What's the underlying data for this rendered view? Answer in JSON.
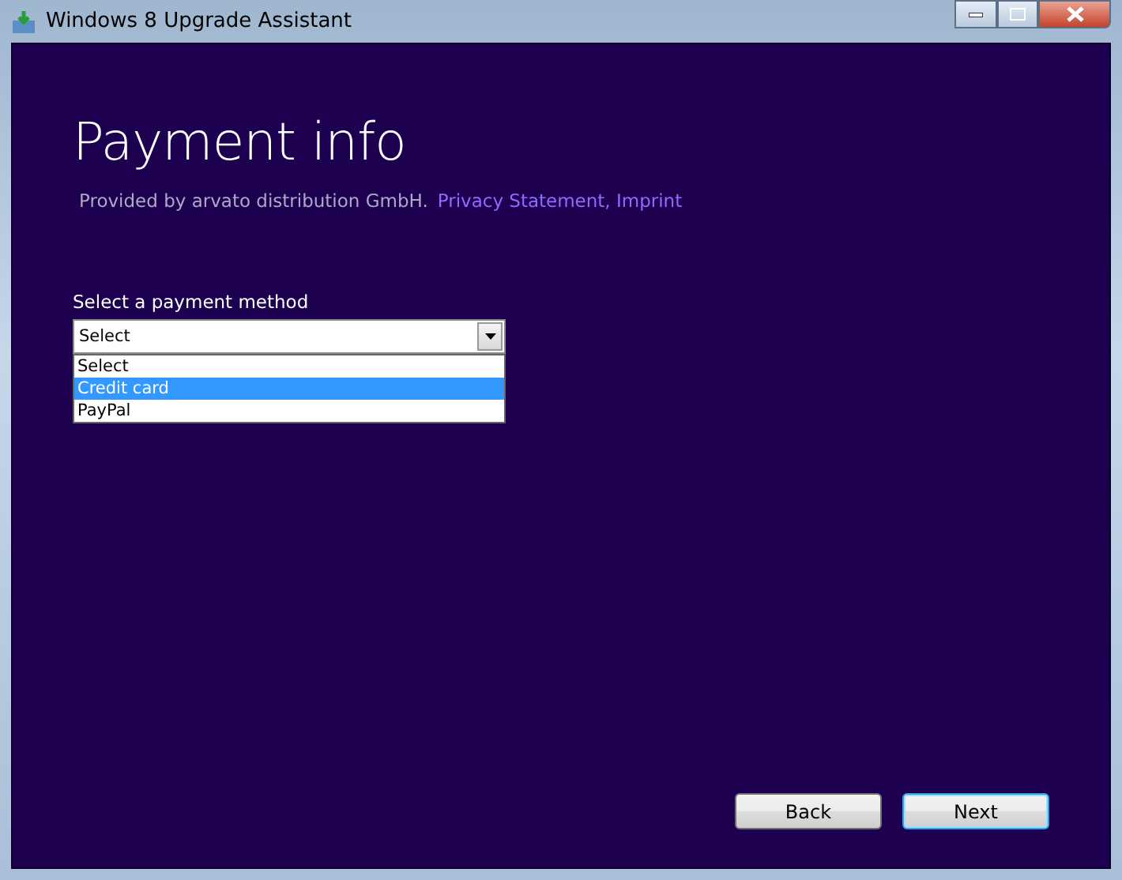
{
  "window": {
    "title": "Windows 8 Upgrade Assistant"
  },
  "page": {
    "title": "Payment info",
    "provider": "Provided by arvato distribution GmbH.",
    "links": [
      "Privacy Statement, Imprint"
    ]
  },
  "payment": {
    "label": "Select a payment method",
    "value": "Select",
    "expanded": true,
    "options": [
      {
        "label": "Select",
        "highlighted": false
      },
      {
        "label": "Credit card",
        "highlighted": true
      },
      {
        "label": "PayPal",
        "highlighted": false
      }
    ]
  },
  "buttons": [
    {
      "label": "Back",
      "focused": false
    },
    {
      "label": "Next",
      "focused": true
    }
  ]
}
